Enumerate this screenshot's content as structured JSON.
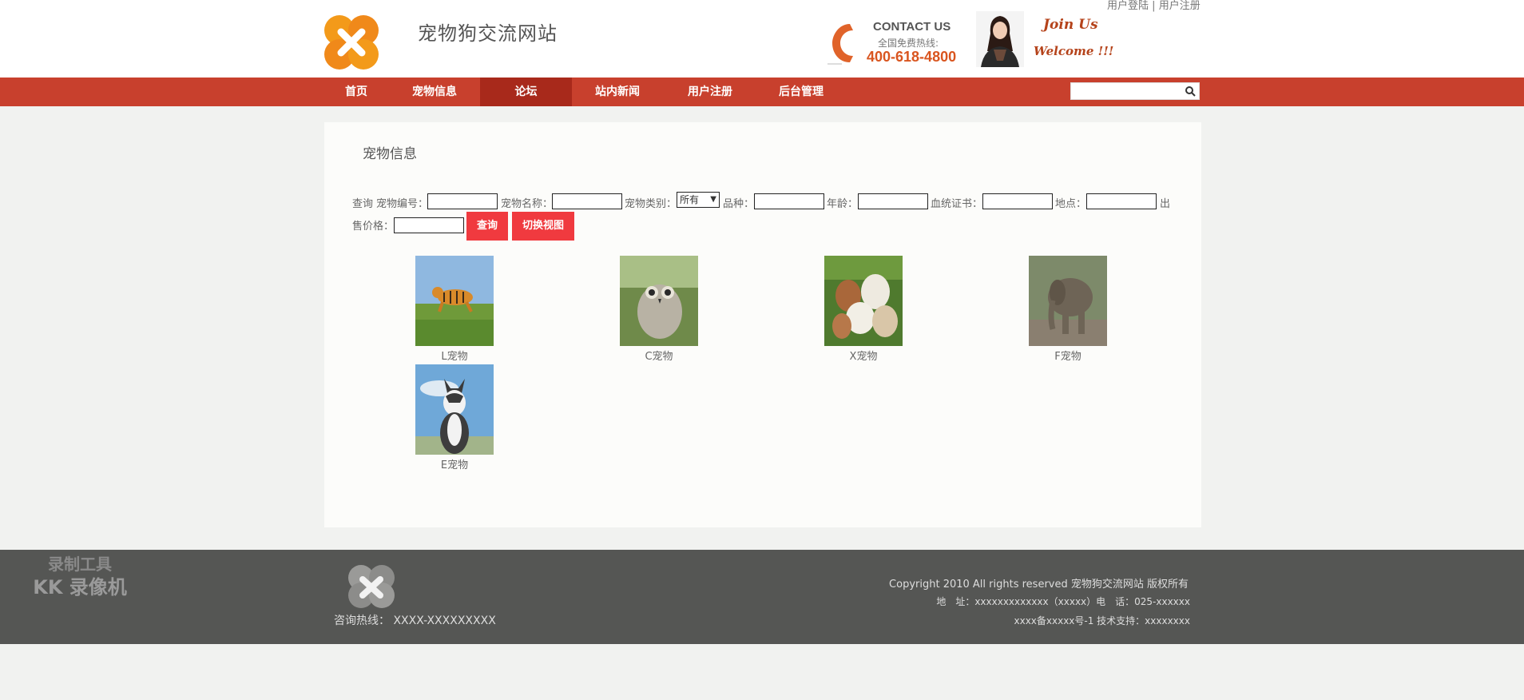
{
  "header": {
    "site_title": "宠物狗交流网站",
    "login_link": "用户登陆",
    "separator": "|",
    "register_link": "用户注册",
    "contact_title": "CONTACT US",
    "contact_sub": "全国免费热线:",
    "contact_phone": "400-618-4800",
    "join_us": "Join Us",
    "welcome": "Welcome !!!"
  },
  "nav": {
    "items": [
      {
        "label": "首页"
      },
      {
        "label": "宠物信息"
      },
      {
        "label": "论坛",
        "active": true
      },
      {
        "label": "站内新闻"
      },
      {
        "label": "用户注册"
      },
      {
        "label": "后台管理"
      }
    ],
    "search_placeholder": ""
  },
  "panel": {
    "title": "宠物信息",
    "query": {
      "prefix": "查询",
      "pet_id_label": "宠物编号：",
      "pet_name_label": "宠物名称：",
      "pet_type_label": "宠物类别：",
      "pet_type_value": "所有",
      "breed_label": "品种：",
      "age_label": "年龄：",
      "pedigree_label": "血统证书：",
      "location_label": "地点：",
      "price_label_part1": "出",
      "price_label_part2": "售价格：",
      "search_button": "查询",
      "switch_button": "切换视图"
    },
    "pets": [
      {
        "name": "L宠物",
        "image": "tiger"
      },
      {
        "name": "C宠物",
        "image": "owl"
      },
      {
        "name": "X宠物",
        "image": "sheep"
      },
      {
        "name": "F宠物",
        "image": "elephant"
      },
      {
        "name": "E宠物",
        "image": "husky"
      }
    ]
  },
  "footer": {
    "hotline": "咨询热线： XXXX-XXXXXXXXX",
    "copyright": "Copyright 2010 All rights reserved 宠物狗交流网站 版权所有",
    "address": "地　址：xxxxxxxxxxxxx（xxxxx）电　话：025-xxxxxx",
    "icp": "xxxx备xxxxx号-1 技术支持：xxxxxxxx"
  },
  "watermark": {
    "line1": "录制工具",
    "line2": "KK 录像机"
  },
  "colors": {
    "nav_bg": "#c8402d",
    "nav_active": "#a8291b",
    "button_red": "#f03a3f",
    "footer_bg": "#555654",
    "logo_orange": "#f09a1a"
  }
}
